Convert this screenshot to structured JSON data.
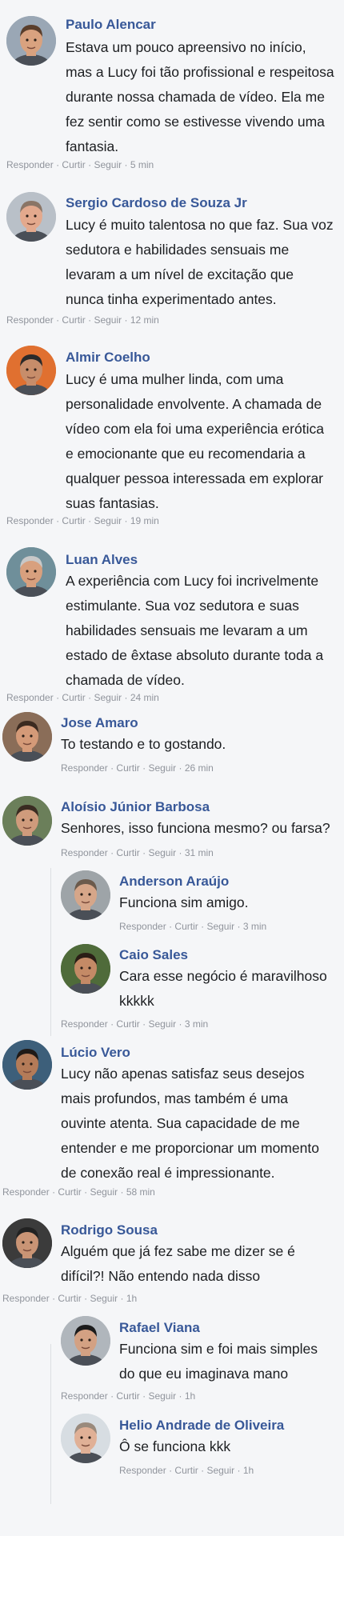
{
  "meta": {
    "reply": "Responder",
    "like": "Curtir",
    "follow": "Seguir",
    "sep": "·"
  },
  "comments": [
    {
      "name": "Paulo Alencar",
      "text": "Estava um pouco apreensivo no início,\nmas a Lucy foi tão profissional e respeitosa\ndurante nossa chamada de vídeo. Ela me\nfez sentir como se estivesse vivendo uma\nfantasia.",
      "time": "5 min",
      "avatar": {
        "skin": "#d9a27f",
        "hair": "#5a3e2b",
        "bg": "#9aa7b5"
      }
    },
    {
      "name": "Sergio Cardoso de Souza Jr",
      "text": "Lucy é muito talentosa no que faz. Sua voz\nsedutora e habilidades sensuais me\nlevaram a um nível de excitação que\nnunca tinha experimentado antes.",
      "time": "12 min",
      "avatar": {
        "skin": "#e3a98d",
        "hair": "#8a7566",
        "bg": "#b9c0c8"
      }
    },
    {
      "name": "Almir Coelho",
      "text": "Lucy é uma mulher linda, com uma\npersonalidade envolvente. A chamada de\nvídeo com ela foi uma experiência erótica\ne emocionante que eu recomendaria a\nqualquer pessoa interessada em explorar\nsuas fantasias.",
      "time": "19 min",
      "avatar": {
        "skin": "#c78d6a",
        "hair": "#2a2a2a",
        "bg": "#e07030"
      }
    },
    {
      "name": "Luan Alves",
      "text": "A experiência com Lucy foi incrivelmente\nestimulante. Sua voz sedutora e suas\nhabilidades sensuais me levaram a um\nestado de êxtase absoluto durante toda a\nchamada de vídeo.",
      "time": "24 min",
      "avatar": {
        "skin": "#d8a07e",
        "hair": "#c8c8c8",
        "bg": "#6f8f9a"
      }
    },
    {
      "name": "Jose Amaro",
      "text": "To testando e to gostando.",
      "time": "26 min",
      "avatar": {
        "skin": "#d49a78",
        "hair": "#3b2a20",
        "bg": "#8a6d58"
      }
    },
    {
      "name": "Aloísio Júnior Barbosa",
      "text": "Senhores, isso funciona mesmo? ou farsa?",
      "time": "31 min",
      "avatar": {
        "skin": "#cf9b7c",
        "hair": "#3a2c22",
        "bg": "#6b7f5a"
      }
    },
    {
      "name": "Anderson Araújo",
      "text": "Funciona sim amigo.",
      "time": "3 min",
      "avatar": {
        "skin": "#d6a689",
        "hair": "#6b5a4c",
        "bg": "#9ea4a8"
      }
    },
    {
      "name": "Caio Sales",
      "text": "Cara esse negócio é maravilhoso\nkkkkk",
      "time": "3 min",
      "avatar": {
        "skin": "#c48a66",
        "hair": "#2b1e16",
        "bg": "#4f6b3a"
      }
    },
    {
      "name": "Lúcio Vero",
      "text": "Lucy não apenas satisfaz seus desejos\nmais profundos, mas também é uma\nouvinte atenta. Sua capacidade de me\nentender e me proporcionar um momento\nde conexão real é impressionante.",
      "time": "58 min",
      "avatar": {
        "skin": "#b47b58",
        "hair": "#1f1a17",
        "bg": "#3d5f7a"
      }
    },
    {
      "name": "Rodrigo Sousa",
      "text": "Alguém que já fez sabe me dizer se é\ndifícil?! Não entendo nada disso",
      "time": "1h",
      "avatar": {
        "skin": "#c99475",
        "hair": "#222222",
        "bg": "#3b3b3b"
      }
    },
    {
      "name": "Rafael Viana",
      "text": "Funciona sim e foi mais simples\ndo que eu imaginava mano",
      "time": "1h",
      "avatar": {
        "skin": "#d3a183",
        "hair": "#1c1c1c",
        "bg": "#b0b6bc"
      }
    },
    {
      "name": "Helio Andrade de Oliveira",
      "text": "Ô se funciona kkk",
      "time": "1h",
      "avatar": {
        "skin": "#e0b096",
        "hair": "#9a8a7c",
        "bg": "#d7dde2"
      }
    }
  ]
}
